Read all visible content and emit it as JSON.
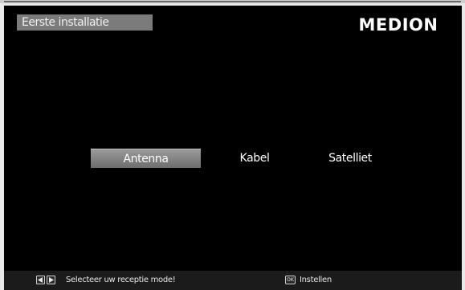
{
  "header": {
    "title": "Eerste installatie",
    "brand": "MEDION"
  },
  "reception_modes": {
    "options": [
      "Antenna",
      "Kabel",
      "Satelliet"
    ],
    "selected": "Antenna"
  },
  "help_bar": {
    "navigate_hint": "Selecteer uw receptie mode!",
    "ok_key_label": "OK",
    "ok_hint": "Instellen"
  },
  "colors": {
    "background": "#000000",
    "title_tab": "#7b7b7b",
    "selected_option": "#8a8a8a",
    "text": "#ffffff"
  },
  "icons": {
    "left": "arrow-left-icon",
    "right": "arrow-right-icon",
    "ok": "ok-key-icon"
  }
}
